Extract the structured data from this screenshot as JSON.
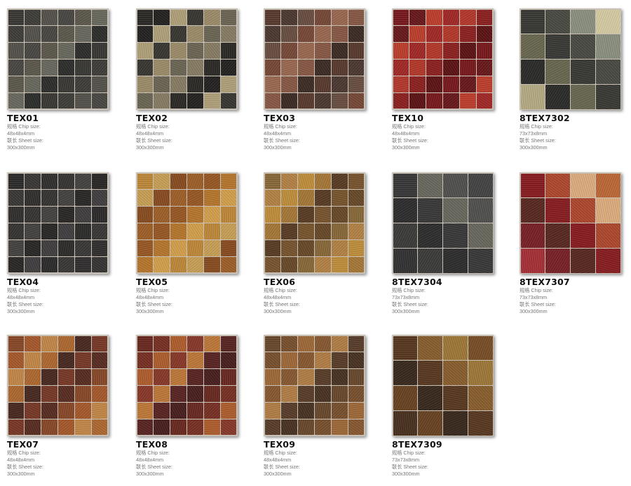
{
  "labels": {
    "chip_size": "规格 Chip size:",
    "sheet_size": "联长 Sheet size:"
  },
  "products": [
    {
      "code": "TEX01",
      "chip": "48x48x4mm",
      "sheet": "300x300mm",
      "grid": 6,
      "palette": [
        "#3b3a36",
        "#4a4944",
        "#2f302e",
        "#56544c",
        "#6b6a60",
        "#403f3b",
        "#5e5a4e"
      ]
    },
    {
      "code": "TEX02",
      "chip": "48x48x4mm",
      "sheet": "300x300mm",
      "grid": 6,
      "palette": [
        "#2c2b28",
        "#3a3832",
        "#8a7f67",
        "#b3a37c",
        "#6d6756",
        "#252422",
        "#9e8f6b"
      ]
    },
    {
      "code": "TEX03",
      "chip": "48x48x4mm",
      "sheet": "300x300mm",
      "grid": 6,
      "palette": [
        "#5a3c30",
        "#7a4a3a",
        "#3e2d27",
        "#6b5043",
        "#8a5a46",
        "#4d3a33",
        "#9c6a52"
      ]
    },
    {
      "code": "TEX10",
      "chip": "48x48x4mm",
      "sheet": "300x300mm",
      "grid": 6,
      "palette": [
        "#7a1a1e",
        "#a42a28",
        "#5e1416",
        "#c0402e",
        "#8e2222",
        "#6a1a1c",
        "#b53a2c"
      ]
    },
    {
      "code": "8TEX7302",
      "chip": "73x73x8mm",
      "sheet": "300x300mm",
      "grid": 4,
      "palette": [
        "#3a3a36",
        "#d8cfa6",
        "#6a6a52",
        "#8e9282",
        "#2c2c2a",
        "#4a4c44",
        "#b7ae86"
      ]
    },
    {
      "code": "TEX04",
      "chip": "48x48x4mm",
      "sheet": "300x300mm",
      "grid": 6,
      "palette": [
        "#2e2d2c",
        "#383634",
        "#424040",
        "#333130",
        "#2a2928",
        "#3c3a38",
        "#464442"
      ]
    },
    {
      "code": "TEX05",
      "chip": "48x48x4mm",
      "sheet": "300x300mm",
      "grid": 6,
      "palette": [
        "#c08a3a",
        "#a0622a",
        "#d6a24e",
        "#8a4e22",
        "#b8782e",
        "#caa258",
        "#9a5a26"
      ]
    },
    {
      "code": "TEX06",
      "chip": "48x48x4mm",
      "sheet": "300x300mm",
      "grid": 6,
      "palette": [
        "#8a6a3a",
        "#a87a3a",
        "#6a4a2a",
        "#c2903e",
        "#7a5630",
        "#b48446",
        "#5a3e26"
      ]
    },
    {
      "code": "8TEX7304",
      "chip": "73x73x8mm",
      "sheet": "300x300mm",
      "grid": 4,
      "palette": [
        "#3a3a3a",
        "#454545",
        "#2f2f2f",
        "#525250",
        "#3d3d3c",
        "#6a6a60",
        "#343434"
      ]
    },
    {
      "code": "8TEX7307",
      "chip": "73x73x8mm",
      "sheet": "300x300mm",
      "grid": 4,
      "palette": [
        "#8a1e22",
        "#c06a3a",
        "#5a2a22",
        "#e0b080",
        "#7a2228",
        "#b04a30",
        "#a83238"
      ]
    },
    {
      "code": "TEX07",
      "chip": "48x48x4mm",
      "sheet": "300x300mm",
      "grid": 6,
      "palette": [
        "#8a4a2a",
        "#b06a32",
        "#5a2e22",
        "#c48a4a",
        "#7a3a28",
        "#a85a2e",
        "#4a2a22"
      ]
    },
    {
      "code": "TEX08",
      "chip": "48x48x4mm",
      "sheet": "300x300mm",
      "grid": 6,
      "palette": [
        "#6a2a22",
        "#8a3a2a",
        "#4a2020",
        "#b0602e",
        "#5a2624",
        "#7a3226",
        "#c07a3a"
      ]
    },
    {
      "code": "TEX09",
      "chip": "48x48x4mm",
      "sheet": "300x300mm",
      "grid": 6,
      "palette": [
        "#6a4a2e",
        "#8a5a32",
        "#4a3424",
        "#a06a3a",
        "#5a3e2a",
        "#7a5230",
        "#b48048"
      ]
    },
    {
      "code": "8TEX7309",
      "chip": "73x73x8mm",
      "sheet": "300x300mm",
      "grid": 4,
      "palette": [
        "#5a3a22",
        "#7a5028",
        "#3a2a1e",
        "#a07a3a",
        "#6a4424",
        "#8a6030",
        "#4a3220"
      ]
    }
  ]
}
